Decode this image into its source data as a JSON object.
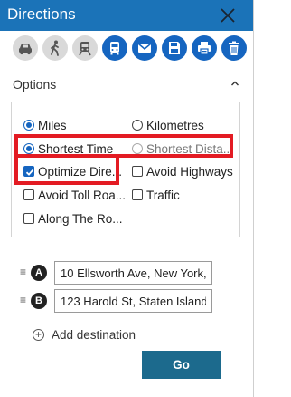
{
  "window": {
    "title": "Directions"
  },
  "toolbar": {
    "buttons": [
      {
        "icon": "car-icon",
        "active": false
      },
      {
        "icon": "walk-icon",
        "active": false
      },
      {
        "icon": "train-icon",
        "active": false
      },
      {
        "icon": "bus-icon",
        "active": true
      },
      {
        "icon": "email-icon",
        "active": true
      },
      {
        "icon": "save-icon",
        "active": true
      },
      {
        "icon": "print-icon",
        "active": true
      },
      {
        "icon": "trash-icon",
        "active": true
      }
    ]
  },
  "options": {
    "header": "Options",
    "miles": {
      "label": "Miles",
      "selected": true
    },
    "kilometres": {
      "label": "Kilometres",
      "selected": false
    },
    "shortest_time": {
      "label": "Shortest Time",
      "selected": true
    },
    "shortest_distance": {
      "label": "Shortest Dista...",
      "selected": false,
      "disabled": true
    },
    "optimize_directions": {
      "label": "Optimize Dire...",
      "checked": true
    },
    "avoid_highways": {
      "label": "Avoid Highways",
      "checked": false
    },
    "avoid_toll_roads": {
      "label": "Avoid Toll Roa...",
      "checked": false
    },
    "traffic": {
      "label": "Traffic",
      "checked": false
    },
    "along_the_route": {
      "label": "Along The Ro...",
      "checked": false
    }
  },
  "waypoints": [
    {
      "marker": "A",
      "value": "10 Ellsworth Ave, New York,"
    },
    {
      "marker": "B",
      "value": "123 Harold St, Staten Island"
    }
  ],
  "add_destination": {
    "label": "Add destination"
  },
  "go_button": {
    "label": "Go"
  },
  "colors": {
    "titlebar": "#1b73b8",
    "accent": "#1565c0",
    "go_button": "#1c6a8d",
    "highlight": "#e31b23"
  }
}
